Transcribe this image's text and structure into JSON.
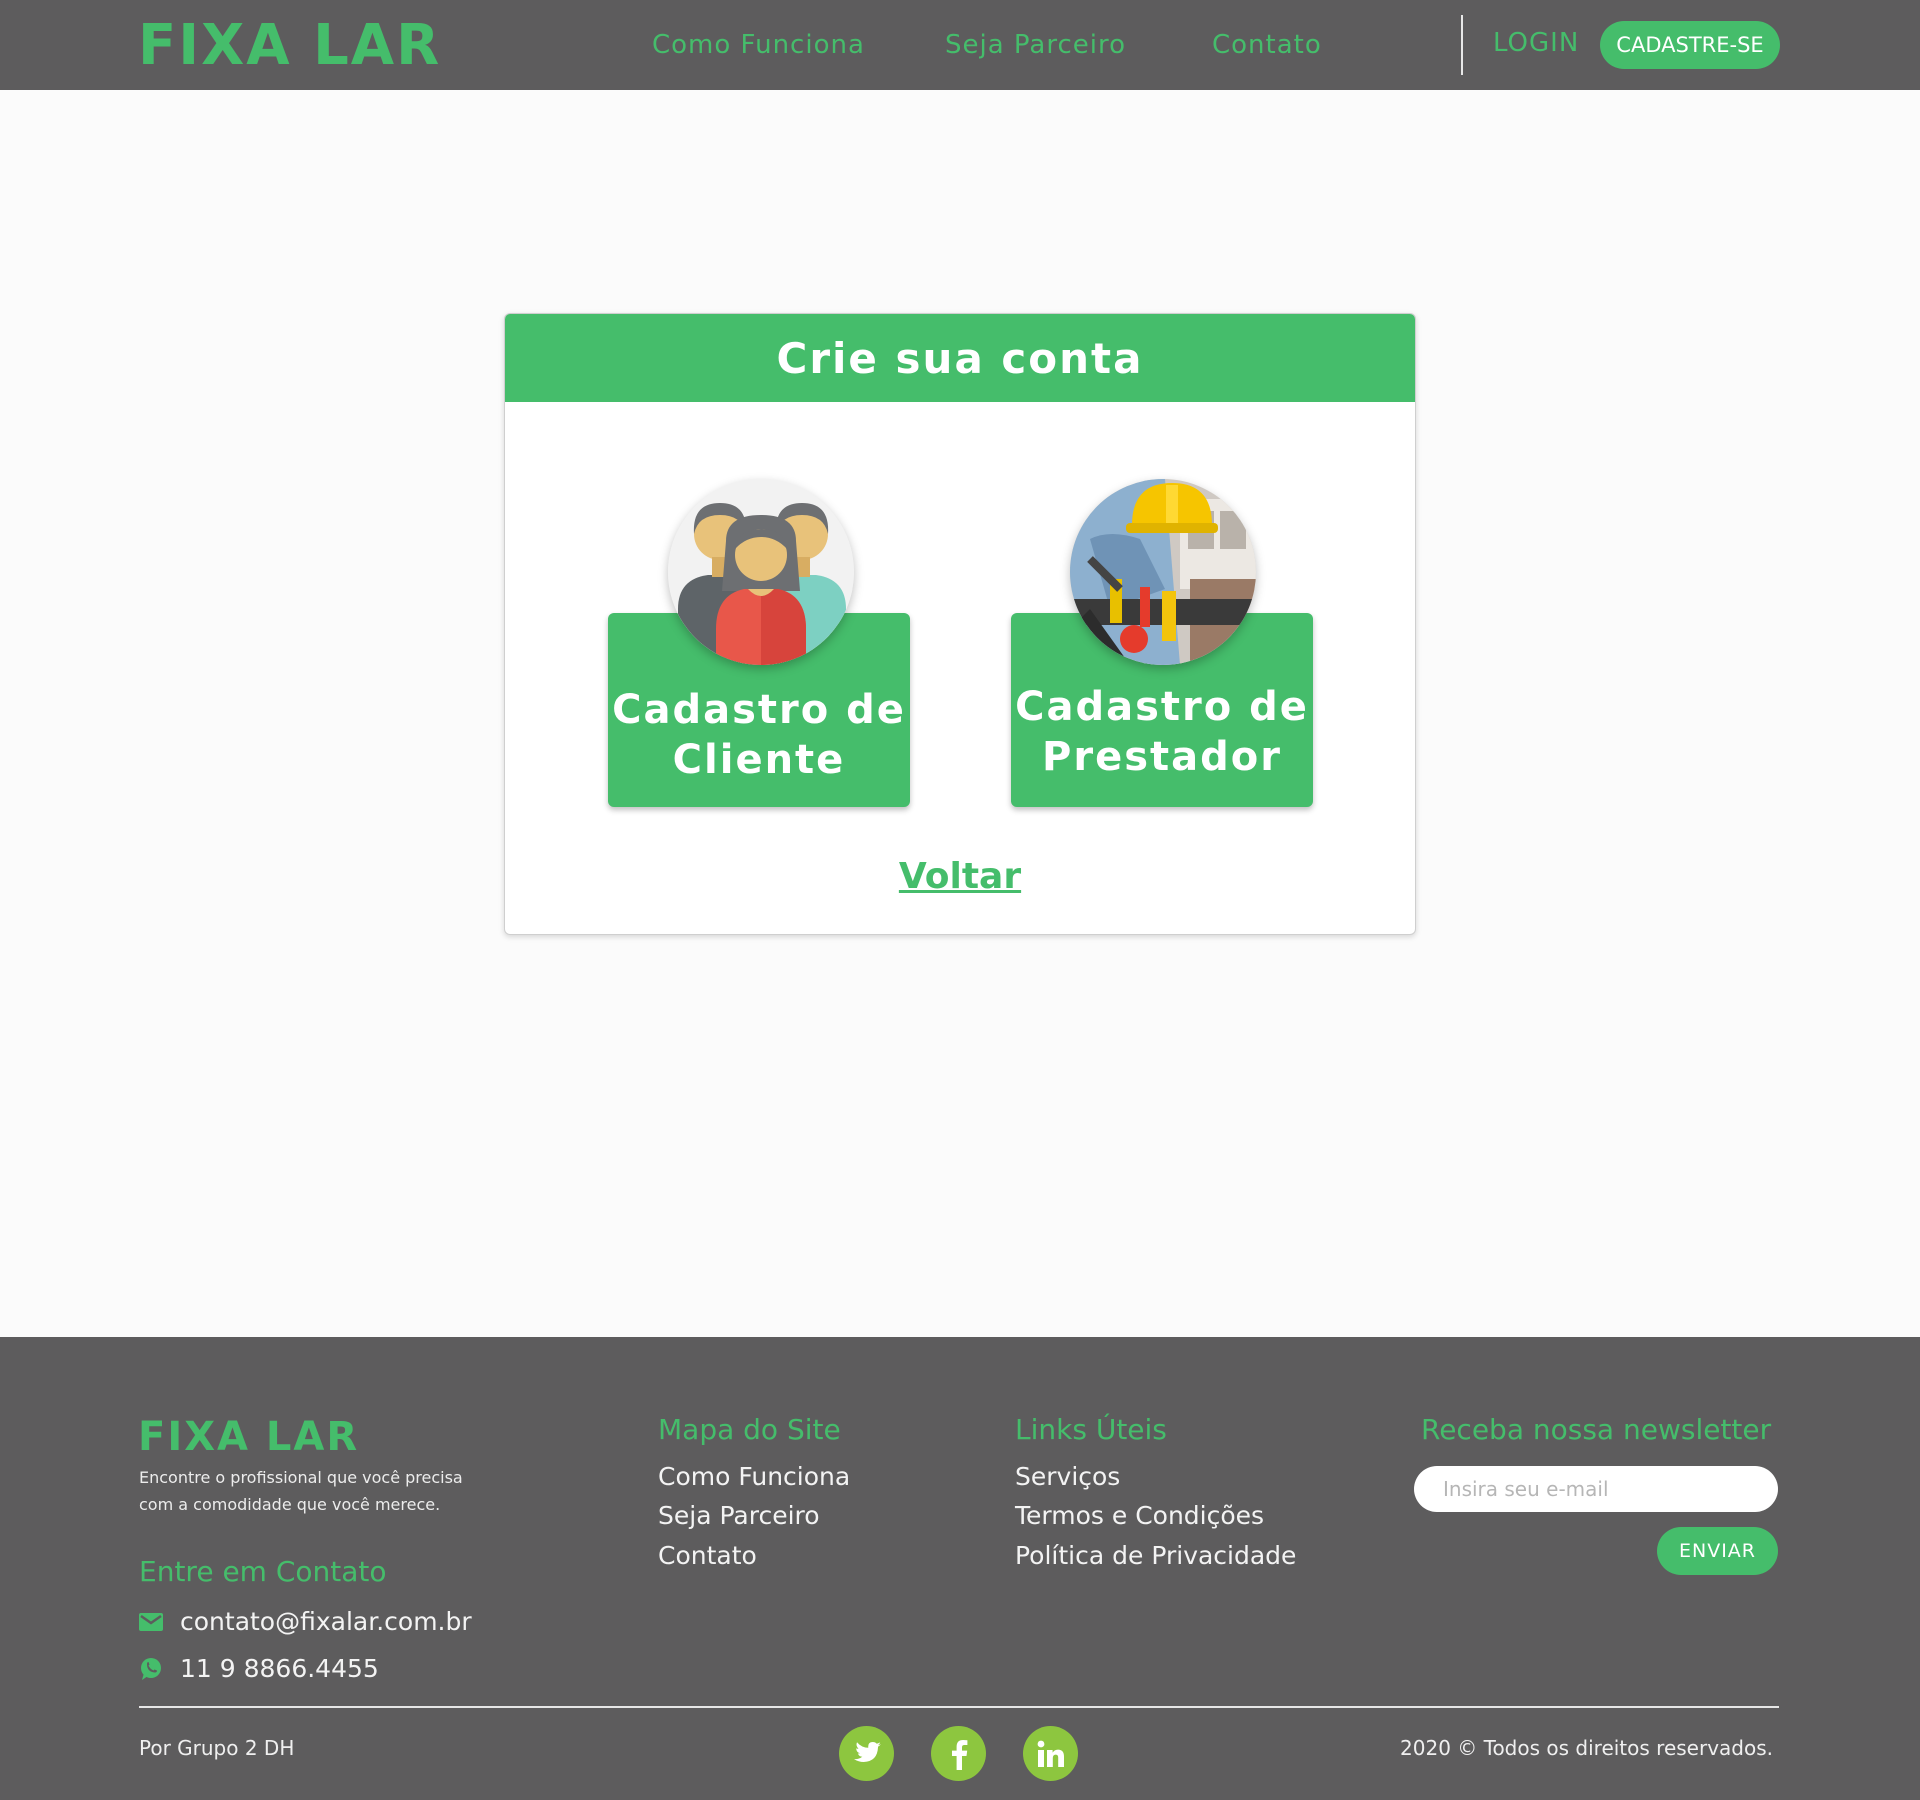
{
  "header": {
    "logo": "FIXA LAR",
    "nav": [
      "Como Funciona",
      "Seja Parceiro",
      "Contato"
    ],
    "login": "LOGIN",
    "signup": "CADASTRE-SE"
  },
  "card": {
    "title": "Crie sua conta",
    "options": [
      {
        "line1": "Cadastro de",
        "line2": "Cliente"
      },
      {
        "line1": "Cadastro de",
        "line2": "Prestador"
      }
    ],
    "back": "Voltar"
  },
  "footer": {
    "logo": "FIXA LAR",
    "tagline_line1": "Encontre o profissional que você precisa",
    "tagline_line2": "com a comodidade que você merece.",
    "contact_heading": "Entre em Contato",
    "email": "contato@fixalar.com.br",
    "phone": "11 9 8866.4455",
    "sitemap_heading": "Mapa do Site",
    "sitemap": [
      "Como Funciona",
      "Seja Parceiro",
      "Contato"
    ],
    "links_heading": "Links Úteis",
    "links": [
      "Serviços",
      "Termos e Condições",
      "Política de Privacidade"
    ],
    "newsletter_heading": "Receba nossa newsletter",
    "newsletter_placeholder": "Insira seu e-mail",
    "send": "ENVIAR",
    "credit": "Por Grupo 2 DH",
    "copyright": "2020 © Todos os direitos reservados."
  },
  "icons": {
    "tools": "tools-icon",
    "email": "email-icon",
    "whatsapp": "whatsapp-icon",
    "twitter": "twitter-icon",
    "facebook": "facebook-icon",
    "linkedin": "linkedin-icon"
  },
  "colors": {
    "brand_green": "#45bd6b",
    "dark_gray": "#5d5c5d",
    "social_green": "#8dc63f"
  }
}
